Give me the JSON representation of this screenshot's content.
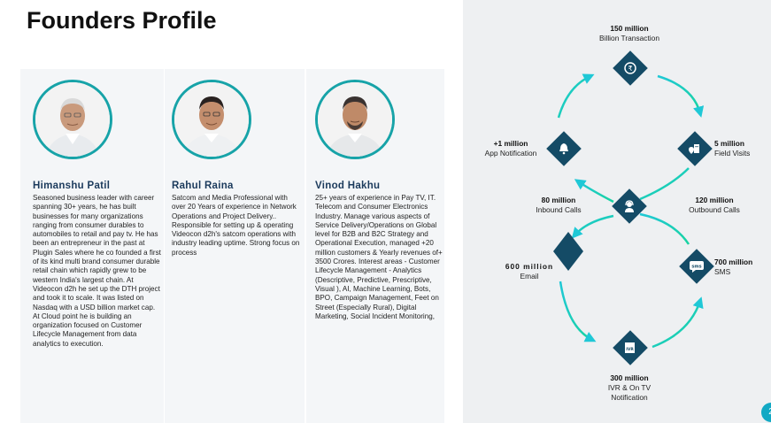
{
  "page": {
    "title": "Founders Profile",
    "page_number": "2"
  },
  "founders": [
    {
      "name": "Himanshu Patil",
      "bio": "Seasoned business leader with career spanning 30+ years, he has built businesses for many organizations ranging from consumer durables to automobiles to retail and pay tv. He has been an entrepreneur in the past at Plugin Sales where he co founded a first of its kind multi brand consumer durable retail chain which rapidly grew to be western India's largest chain. At Videocon d2h he set up the DTH project and took it to scale. It was listed on Nasdaq with a USD billion market cap. At Cloud point he is building an organization focused on Customer Lifecycle Management from data analytics to execution."
    },
    {
      "name": "Rahul Raina",
      "bio": "Satcom and Media Professional with over 20 Years of experience in Network Operations and Project Delivery.. Responsible for setting up & operating Videocon d2h's satcom operations with industry leading uptime. Strong focus on process"
    },
    {
      "name": "Vinod Hakhu",
      "bio": "25+ years of experience in Pay TV, IT. Telecom and Consumer Electronics Industry. Manage various aspects of Service Delivery/Operations on Global level for B2B and B2C Strategy and Operational Execution, managed +20 million customers & Yearly revenues of+ 3500 Crores. Interest areas - Customer Lifecycle Management - Analytics (Descriptive, Predictive, Prescriptive, Visual ), AI, Machine Learning, Bots, BPO, Campaign Management, Feet on Street (Especially Rural), Digital Marketing, Social Incident Monitoring,"
    }
  ],
  "diagram": {
    "billion": {
      "value": "150 million",
      "label": "Billion Transaction",
      "icon": "rupee-coin-icon"
    },
    "app": {
      "value": "+1 million",
      "label": "App Notification",
      "icon": "bell-icon"
    },
    "field": {
      "value": "5 million",
      "label": "Field Visits",
      "icon": "map-pin-icon"
    },
    "inbound": {
      "value": "80 million",
      "label": "Inbound Calls"
    },
    "outbound": {
      "value": "120 million",
      "label": "Outbound Calls"
    },
    "center": {
      "icon": "headset-agent-icon"
    },
    "email": {
      "value": "600 million",
      "label": "Email"
    },
    "sms": {
      "value": "700 million",
      "label": "SMS",
      "icon": "sms-icon"
    },
    "ivr": {
      "value": "300 million",
      "label": "IVR & On TV",
      "label2": "Notification",
      "icon": "ivr-icon"
    },
    "colors": {
      "node": "#144b66",
      "arrow_start": "#1fc8d6",
      "arrow_end": "#18d3a0"
    }
  }
}
